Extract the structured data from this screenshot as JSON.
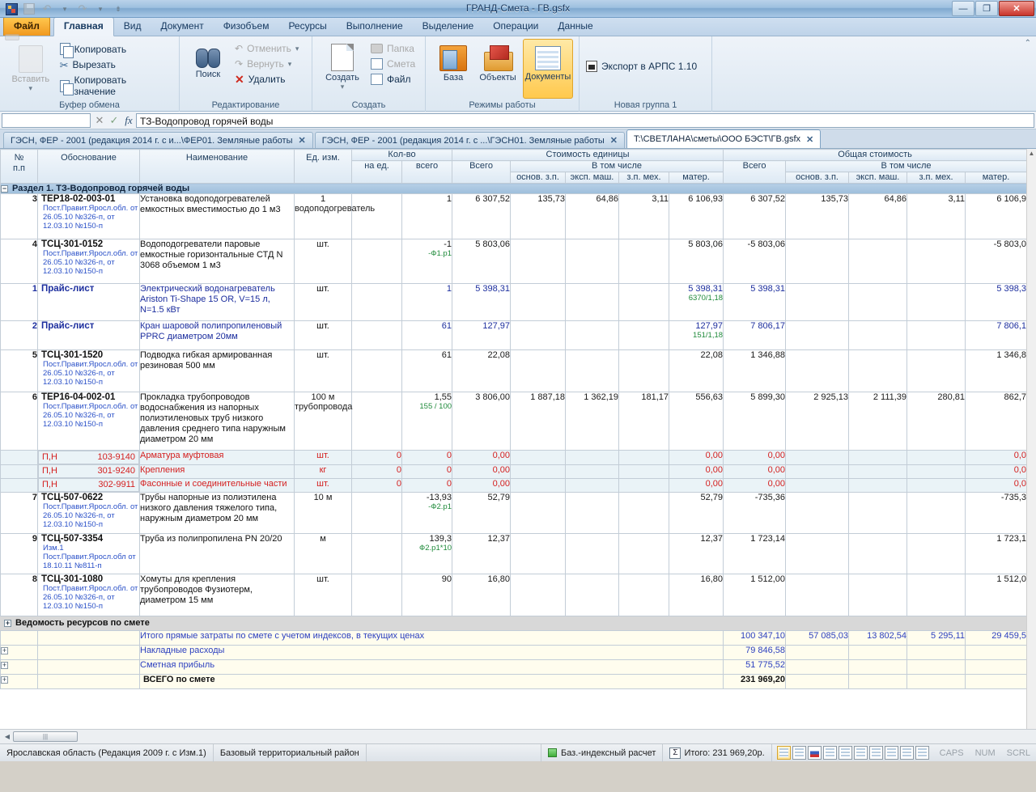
{
  "window": {
    "title": "ГРАНД-Смета - ГВ.gsfx",
    "min_label": "—",
    "max_label": "❐",
    "close_label": "✕"
  },
  "ribbon": {
    "tabs": [
      {
        "label": "Файл",
        "type": "file"
      },
      {
        "label": "Главная",
        "type": "active"
      },
      {
        "label": "Вид",
        "type": "normal"
      },
      {
        "label": "Документ",
        "type": "normal"
      },
      {
        "label": "Физобъем",
        "type": "normal"
      },
      {
        "label": "Ресурсы",
        "type": "normal"
      },
      {
        "label": "Выполнение",
        "type": "normal"
      },
      {
        "label": "Выделение",
        "type": "normal"
      },
      {
        "label": "Операции",
        "type": "normal"
      },
      {
        "label": "Данные",
        "type": "normal"
      }
    ],
    "groups": [
      {
        "title": "Буфер обмена",
        "big": {
          "label": "Вставить",
          "icon": "paste-icon",
          "disabled": true
        },
        "small": [
          {
            "label": "Копировать",
            "icon": "copy-icon",
            "disabled": false
          },
          {
            "label": "Вырезать",
            "icon": "scissors-icon",
            "disabled": false
          },
          {
            "label": "Копировать значение",
            "icon": "copy-value-icon",
            "disabled": false
          }
        ]
      },
      {
        "title": "Редактирование",
        "big": {
          "label": "Поиск",
          "icon": "binoculars-icon",
          "disabled": false
        },
        "small": [
          {
            "label": "Отменить",
            "icon": "undo-icon",
            "disabled": true
          },
          {
            "label": "Вернуть",
            "icon": "redo-icon",
            "disabled": true
          },
          {
            "label": "Удалить",
            "icon": "delete-icon",
            "disabled": false
          }
        ]
      },
      {
        "title": "Создать",
        "big": {
          "label": "Создать",
          "icon": "new-document-icon",
          "disabled": false
        },
        "small": [
          {
            "label": "Папка",
            "icon": "folder-icon",
            "disabled": true
          },
          {
            "label": "Смета",
            "icon": "estimate-icon",
            "disabled": true
          },
          {
            "label": "Файл",
            "icon": "file-icon",
            "disabled": false
          }
        ]
      },
      {
        "title": "Режимы работы",
        "buttons": [
          {
            "label": "База",
            "icon": "database-icon",
            "selected": false
          },
          {
            "label": "Объекты",
            "icon": "objects-icon",
            "selected": false
          },
          {
            "label": "Документы",
            "icon": "documents-icon",
            "selected": true
          }
        ]
      },
      {
        "title": "Новая группа 1",
        "small": [
          {
            "label": "Экспорт в АРПС 1.10",
            "icon": "arps-export-icon",
            "disabled": false
          }
        ]
      }
    ],
    "collapse_icon": "chevron-up-icon"
  },
  "formula_bar": {
    "namebox_value": "",
    "cancel_icon": "✕",
    "accept_icon": "✓",
    "fx_icon": "fx",
    "value": "ТЗ-Водопровод горячей воды"
  },
  "doc_tabs": [
    {
      "label": "ГЭСН, ФЕР - 2001 (редакция 2014 г. с и...\\ФЕР01. Земляные работы",
      "active": false,
      "close": "✕"
    },
    {
      "label": "ГЭСН, ФЕР - 2001 (редакция 2014 г. с ...\\ГЭСН01. Земляные работы",
      "active": false,
      "close": "✕"
    },
    {
      "label": "T:\\СВЕТЛАНА\\сметы\\ООО БЭСТ\\ГВ.gsfx",
      "active": true,
      "close": "✕"
    }
  ],
  "grid": {
    "headers": {
      "np": "№\nп.п",
      "obosnovanie": "Обоснование",
      "naimenovanie": "Наименование",
      "ed_izm": "Ед. изм.",
      "kolvo": "Кол-во",
      "na_ed": "на ед.",
      "vsego": "всего",
      "stoimost_edinicy": "Стоимость единицы",
      "obshaya_stoimost": "Общая стоимость",
      "vsego_single": "Всего",
      "v_tom_chisle": "В том числе",
      "osnov_zp": "основ. з.п.",
      "eksp_mash": "эксп. маш.",
      "zp_meh": "з.п. мех.",
      "mater": "матер."
    },
    "section": {
      "label": "Раздел 1. ТЗ-Водопровод горячей воды",
      "expander": "−"
    },
    "rows": [
      {
        "np": "3",
        "code": "ТЕР18-02-003-01",
        "justification": "Пост.Правит.Яросл.обл. от 26.05.10 №326-п, от 12.03.10 №150-п",
        "name": "Установка водоподогревателей емкостных вместимостью до 1 м3",
        "unit": "1 водоподогреватель",
        "na_ed": "",
        "vsego_kol": "1",
        "vsego_kol_sub": "",
        "u_vsego": "6 307,52",
        "u_osnov": "135,73",
        "u_eksp": "64,86",
        "u_zpmeh": "3,11",
        "u_mater": "6 106,93",
        "u_mater_sub": "",
        "t_vsego": "6 307,52",
        "t_osnov": "135,73",
        "t_eksp": "64,86",
        "t_zpmeh": "3,11",
        "t_mater": "6 106,9",
        "style": "black",
        "expanders": 2
      },
      {
        "np": "4",
        "code": "ТСЦ-301-0152",
        "justification": "Пост.Правит.Яросл.обл. от 26.05.10 №326-п, от 12.03.10 №150-п",
        "name": "Водоподогреватели паровые емкостные горизонтальные СТД N 3068 объемом 1 м3",
        "unit": "шт.",
        "na_ed": "",
        "vsego_kol": "-1",
        "vsego_kol_sub": "-Ф1.р1",
        "u_vsego": "5 803,06",
        "u_osnov": "",
        "u_eksp": "",
        "u_zpmeh": "",
        "u_mater": "5 803,06",
        "u_mater_sub": "",
        "t_vsego": "-5 803,06",
        "t_osnov": "",
        "t_eksp": "",
        "t_zpmeh": "",
        "t_mater": "-5 803,0",
        "style": "black",
        "expanders": 1
      },
      {
        "np": "1",
        "code": "Прайс-лист",
        "justification": "",
        "name": "Электрический водонагреватель Ariston Ti-Shape 15 OR,  V=15 л, N=1.5 кВт",
        "unit": "шт.",
        "na_ed": "",
        "vsego_kol": "1",
        "vsego_kol_sub": "",
        "u_vsego": "5 398,31",
        "u_osnov": "",
        "u_eksp": "",
        "u_zpmeh": "",
        "u_mater": "5 398,31",
        "u_mater_sub": "6370/1,18",
        "t_vsego": "5 398,31",
        "t_osnov": "",
        "t_eksp": "",
        "t_zpmeh": "",
        "t_mater": "5 398,3",
        "style": "blue",
        "expanders": 1
      },
      {
        "np": "2",
        "code": "Прайс-лист",
        "justification": "",
        "name": "Кран шаровой полипропиленовый PPRC диаметром 20мм",
        "unit": "шт.",
        "na_ed": "",
        "vsego_kol": "61",
        "vsego_kol_sub": "",
        "u_vsego": "127,97",
        "u_osnov": "",
        "u_eksp": "",
        "u_zpmeh": "",
        "u_mater": "127,97",
        "u_mater_sub": "151/1,18",
        "t_vsego": "7 806,17",
        "t_osnov": "",
        "t_eksp": "",
        "t_zpmeh": "",
        "t_mater": "7 806,1",
        "style": "blue",
        "expanders": 1
      },
      {
        "np": "5",
        "code": "ТСЦ-301-1520",
        "justification": "Пост.Правит.Яросл.обл. от 26.05.10 №326-п, от 12.03.10 №150-п",
        "name": "Подводка гибкая армированная резиновая 500 мм",
        "unit": "шт.",
        "na_ed": "",
        "vsego_kol": "61",
        "vsego_kol_sub": "",
        "u_vsego": "22,08",
        "u_osnov": "",
        "u_eksp": "",
        "u_zpmeh": "",
        "u_mater": "22,08",
        "u_mater_sub": "",
        "t_vsego": "1 346,88",
        "t_osnov": "",
        "t_eksp": "",
        "t_zpmeh": "",
        "t_mater": "1 346,8",
        "style": "black",
        "expanders": 1
      },
      {
        "np": "6",
        "code": "ТЕР16-04-002-01",
        "justification": "Пост.Правит.Яросл.обл. от 26.05.10 №326-п, от 12.03.10 №150-п",
        "name": "Прокладка трубопроводов водоснабжения из напорных полиэтиленовых труб низкого давления среднего типа наружным диаметром 20 мм",
        "unit": "100 м трубопровода",
        "na_ed": "",
        "vsego_kol": "1,55",
        "vsego_kol_sub": "155 / 100",
        "u_vsego": "3 806,00",
        "u_osnov": "1 887,18",
        "u_eksp": "1 362,19",
        "u_zpmeh": "181,17",
        "u_mater": "556,63",
        "u_mater_sub": "",
        "t_vsego": "5 899,30",
        "t_osnov": "2 925,13",
        "t_eksp": "2 111,39",
        "t_zpmeh": "280,81",
        "t_mater": "862,7",
        "style": "black",
        "expanders": 2
      },
      {
        "np": "",
        "code": "П,Н",
        "code2": "103-9140",
        "justification": "",
        "name": "Арматура муфтовая",
        "unit": "шт.",
        "na_ed": "0",
        "vsego_kol": "0",
        "vsego_kol_sub": "",
        "u_vsego": "0,00",
        "u_osnov": "",
        "u_eksp": "",
        "u_zpmeh": "",
        "u_mater": "0,00",
        "u_mater_sub": "",
        "t_vsego": "0,00",
        "t_osnov": "",
        "t_eksp": "",
        "t_zpmeh": "",
        "t_mater": "0,0",
        "style": "red",
        "expanders": 0
      },
      {
        "np": "",
        "code": "П,Н",
        "code2": "301-9240",
        "justification": "",
        "name": "Крепления",
        "unit": "кг",
        "na_ed": "0",
        "vsego_kol": "0",
        "vsego_kol_sub": "",
        "u_vsego": "0,00",
        "u_osnov": "",
        "u_eksp": "",
        "u_zpmeh": "",
        "u_mater": "0,00",
        "u_mater_sub": "",
        "t_vsego": "0,00",
        "t_osnov": "",
        "t_eksp": "",
        "t_zpmeh": "",
        "t_mater": "0,0",
        "style": "red",
        "expanders": 0
      },
      {
        "np": "",
        "code": "П,Н",
        "code2": "302-9911",
        "justification": "",
        "name": "Фасонные и соединительные части",
        "unit": "шт.",
        "na_ed": "0",
        "vsego_kol": "0",
        "vsego_kol_sub": "",
        "u_vsego": "0,00",
        "u_osnov": "",
        "u_eksp": "",
        "u_zpmeh": "",
        "u_mater": "0,00",
        "u_mater_sub": "",
        "t_vsego": "0,00",
        "t_osnov": "",
        "t_eksp": "",
        "t_zpmeh": "",
        "t_mater": "0,0",
        "style": "red",
        "expanders": 0
      },
      {
        "np": "7",
        "code": "ТСЦ-507-0622",
        "justification": "Пост.Правит.Яросл.обл. от 26.05.10 №326-п, от 12.03.10 №150-п",
        "name": "Трубы напорные из полиэтилена низкого давления тяжелого типа, наружным диаметром 20 мм",
        "unit": "10 м",
        "na_ed": "",
        "vsego_kol": "-13,93",
        "vsego_kol_sub": "-Ф2.р1",
        "u_vsego": "52,79",
        "u_osnov": "",
        "u_eksp": "",
        "u_zpmeh": "",
        "u_mater": "52,79",
        "u_mater_sub": "",
        "t_vsego": "-735,36",
        "t_osnov": "",
        "t_eksp": "",
        "t_zpmeh": "",
        "t_mater": "-735,3",
        "style": "black",
        "expanders": 1
      },
      {
        "np": "9",
        "code": "ТСЦ-507-3354",
        "justification": "Изм.1\nПост.Правит.Яросл.обл от 18.10.11 №811-п",
        "name": "Труба из полипропилена PN 20/20",
        "unit": "м",
        "na_ed": "",
        "vsego_kol": "139,3",
        "vsego_kol_sub": "Ф2.р1*10",
        "u_vsego": "12,37",
        "u_osnov": "",
        "u_eksp": "",
        "u_zpmeh": "",
        "u_mater": "12,37",
        "u_mater_sub": "",
        "t_vsego": "1 723,14",
        "t_osnov": "",
        "t_eksp": "",
        "t_zpmeh": "",
        "t_mater": "1 723,1",
        "style": "black",
        "expanders": 1
      },
      {
        "np": "8",
        "code": "ТСЦ-301-1080",
        "justification": "Пост.Правит.Яросл.обл. от 26.05.10 №326-п, от 12.03.10 №150-п",
        "name": "Хомуты для крепления трубопроводов Фузиотерм, диаметром 15 мм",
        "unit": "шт.",
        "na_ed": "",
        "vsego_kol": "90",
        "vsego_kol_sub": "",
        "u_vsego": "16,80",
        "u_osnov": "",
        "u_eksp": "",
        "u_zpmeh": "",
        "u_mater": "16,80",
        "u_mater_sub": "",
        "t_vsego": "1 512,00",
        "t_osnov": "",
        "t_eksp": "",
        "t_zpmeh": "",
        "t_mater": "1 512,0",
        "style": "black",
        "expanders": 1
      }
    ],
    "resource_sheet": {
      "label": "Ведомость ресурсов по смете",
      "expander": "+"
    },
    "totals": [
      {
        "label": "Итого прямые затраты по смете с учетом индексов, в текущих ценах",
        "expander": "",
        "t_vsego": "100 347,10",
        "t_osnov": "57 085,03",
        "t_eksp": "13 802,54",
        "t_zpmeh": "5 295,11",
        "t_mater": "29 459,5",
        "bold": false
      },
      {
        "label": "Накладные расходы",
        "expander": "+",
        "t_vsego": "79 846,58",
        "t_osnov": "",
        "t_eksp": "",
        "t_zpmeh": "",
        "t_mater": "",
        "bold": false
      },
      {
        "label": "Сметная прибыль",
        "expander": "+",
        "t_vsego": "51 775,52",
        "t_osnov": "",
        "t_eksp": "",
        "t_zpmeh": "",
        "t_mater": "",
        "bold": false
      },
      {
        "label": "ВСЕГО по смете",
        "expander": "+",
        "t_vsego": "231 969,20",
        "t_osnov": "",
        "t_eksp": "",
        "t_zpmeh": "",
        "t_mater": "",
        "bold": true
      }
    ]
  },
  "scroll": {
    "left_arrow": "◀",
    "right_arrow": "▶",
    "up_arrow": "▲",
    "down_arrow": "▼",
    "thumb_grip": "|||"
  },
  "statusbar": {
    "region": "Ярославская область (Редакция 2009 г. с Изм.1)",
    "zone": "Базовый территориальный район",
    "calc_mode": "Баз.-индексный расчет",
    "sum_icon": "Σ",
    "total": "Итого: 231 969,20р.",
    "indicators": [
      "CAPS",
      "NUM",
      "SCRL"
    ],
    "mini_icons": [
      "grid-view-icon",
      "table-view-icon",
      "flag-icon",
      "tsn-icon",
      "clock-icon",
      "hp-icon",
      "pencil-icon",
      "coins-icon",
      "chart-icon",
      "calc-icon"
    ]
  },
  "colors": {
    "accent": "#f0981f",
    "link": "#1c2e9e",
    "negative": "#d42020",
    "green": "#1f8a3a",
    "section": "#9dbedb"
  }
}
